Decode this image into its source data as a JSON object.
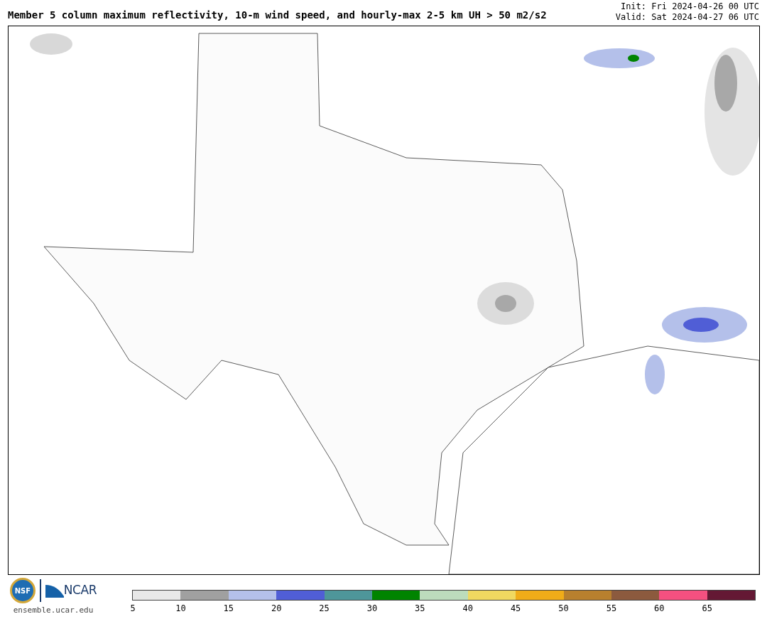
{
  "title": "Member 5 column maximum reflectivity, 10-m wind speed, and hourly-max 2-5 km UH > 50 m2/s2",
  "init": "Init: Fri 2024-04-26 00 UTC",
  "valid": "Valid: Sat 2024-04-27 06 UTC",
  "logos": {
    "nsf": "NSF",
    "ncar": "NCAR",
    "url": "ensemble.ucar.edu"
  },
  "legend": [
    {
      "label": "5",
      "color": "#e8e8e8"
    },
    {
      "label": "10",
      "color": "#a0a0a0"
    },
    {
      "label": "15",
      "color": "#b4c0ea"
    },
    {
      "label": "20",
      "color": "#505ed6"
    },
    {
      "label": "25",
      "color": "#4e969a"
    },
    {
      "label": "30",
      "color": "#008400"
    },
    {
      "label": "35",
      "color": "#bcdcbc"
    },
    {
      "label": "40",
      "color": "#f0d860"
    },
    {
      "label": "45",
      "color": "#f0ac18"
    },
    {
      "label": "50",
      "color": "#b8802e"
    },
    {
      "label": "55",
      "color": "#8c5a3e"
    },
    {
      "label": "60",
      "color": "#f45080"
    },
    {
      "label": "65",
      "color": "#641834"
    }
  ]
}
